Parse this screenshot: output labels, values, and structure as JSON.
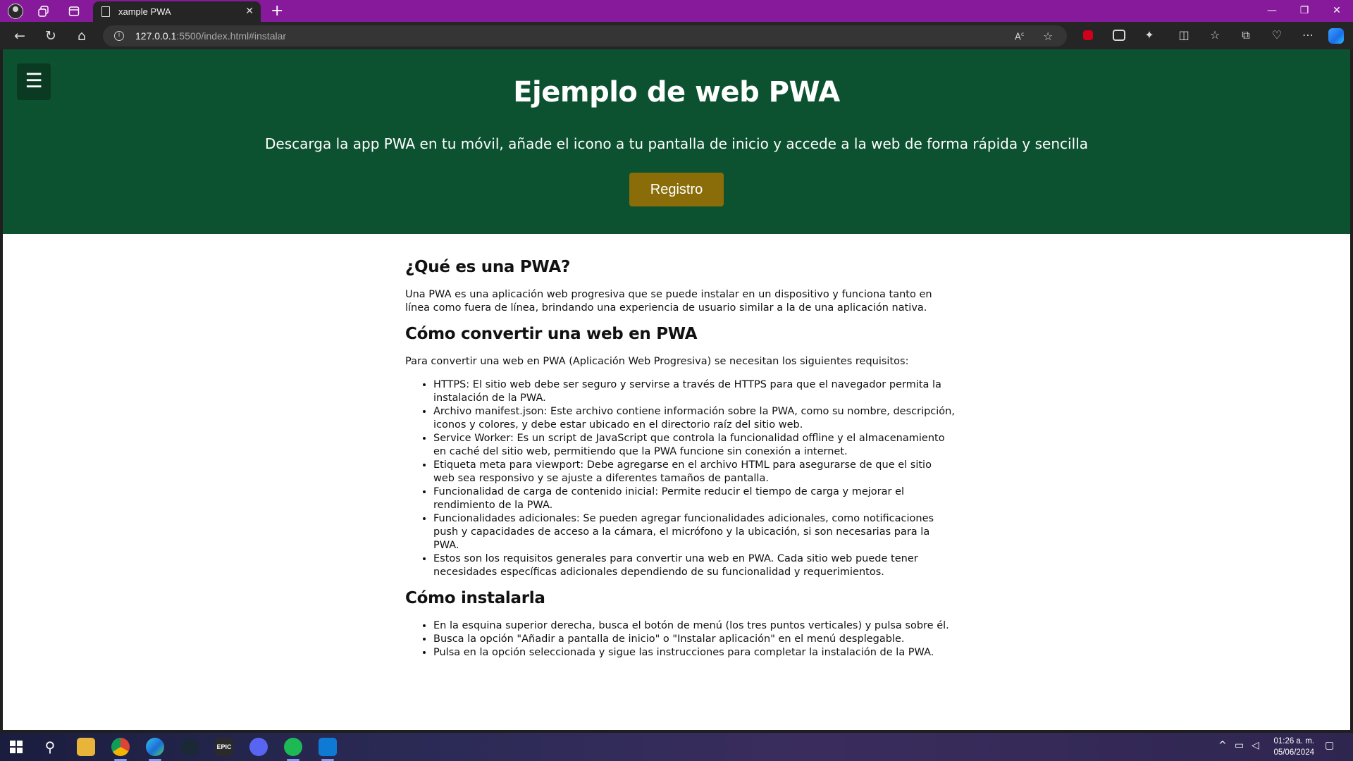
{
  "browser": {
    "tab_title": "xample PWA",
    "url_host": "127.0.0.1",
    "url_rest": ":5500/index.html#instalar",
    "new_tab": "+",
    "close_tab": "✕"
  },
  "hero": {
    "menu_icon": "☰",
    "title": "Ejemplo de web PWA",
    "subtitle": "Descarga la app PWA en tu móvil, añade el icono a tu pantalla de inicio y accede a la web de forma rápida y sencilla",
    "button": "Registro",
    "colors": {
      "background": "#0d5230",
      "button": "#8a6d08"
    }
  },
  "sections": {
    "what": {
      "heading": "¿Qué es una PWA?",
      "text": "Una PWA es una aplicación web progresiva que se puede instalar en un dispositivo y funciona tanto en línea como fuera de línea, brindando una experiencia de usuario similar a la de una aplicación nativa."
    },
    "convert": {
      "heading": "Cómo convertir una web en PWA",
      "intro": "Para convertir una web en PWA (Aplicación Web Progresiva) se necesitan los siguientes requisitos:",
      "items": [
        "HTTPS: El sitio web debe ser seguro y servirse a través de HTTPS para que el navegador permita la instalación de la PWA.",
        "Archivo manifest.json: Este archivo contiene información sobre la PWA, como su nombre, descripción, iconos y colores, y debe estar ubicado en el directorio raíz del sitio web.",
        "Service Worker: Es un script de JavaScript que controla la funcionalidad offline y el almacenamiento en caché del sitio web, permitiendo que la PWA funcione sin conexión a internet.",
        "Etiqueta meta para viewport: Debe agregarse en el archivo HTML para asegurarse de que el sitio web sea responsivo y se ajuste a diferentes tamaños de pantalla.",
        "Funcionalidad de carga de contenido inicial: Permite reducir el tiempo de carga y mejorar el rendimiento de la PWA.",
        "Funcionalidades adicionales: Se pueden agregar funcionalidades adicionales, como notificaciones push y capacidades de acceso a la cámara, el micrófono y la ubicación, si son necesarias para la PWA.",
        "Estos son los requisitos generales para convertir una web en PWA. Cada sitio web puede tener necesidades específicas adicionales dependiendo de su funcionalidad y requerimientos."
      ]
    },
    "install": {
      "heading": "Cómo instalarla",
      "items": [
        "En la esquina superior derecha, busca el botón de menú (los tres puntos verticales) y pulsa sobre él.",
        "Busca la opción \"Añadir a pantalla de inicio\" o \"Instalar aplicación\" en el menú desplegable.",
        "Pulsa en la opción seleccionada y sigue las instrucciones para completar la instalación de la PWA."
      ]
    }
  },
  "taskbar": {
    "epic_label": "EPIC",
    "time": "01:26 a. m.",
    "date": "05/06/2024"
  }
}
